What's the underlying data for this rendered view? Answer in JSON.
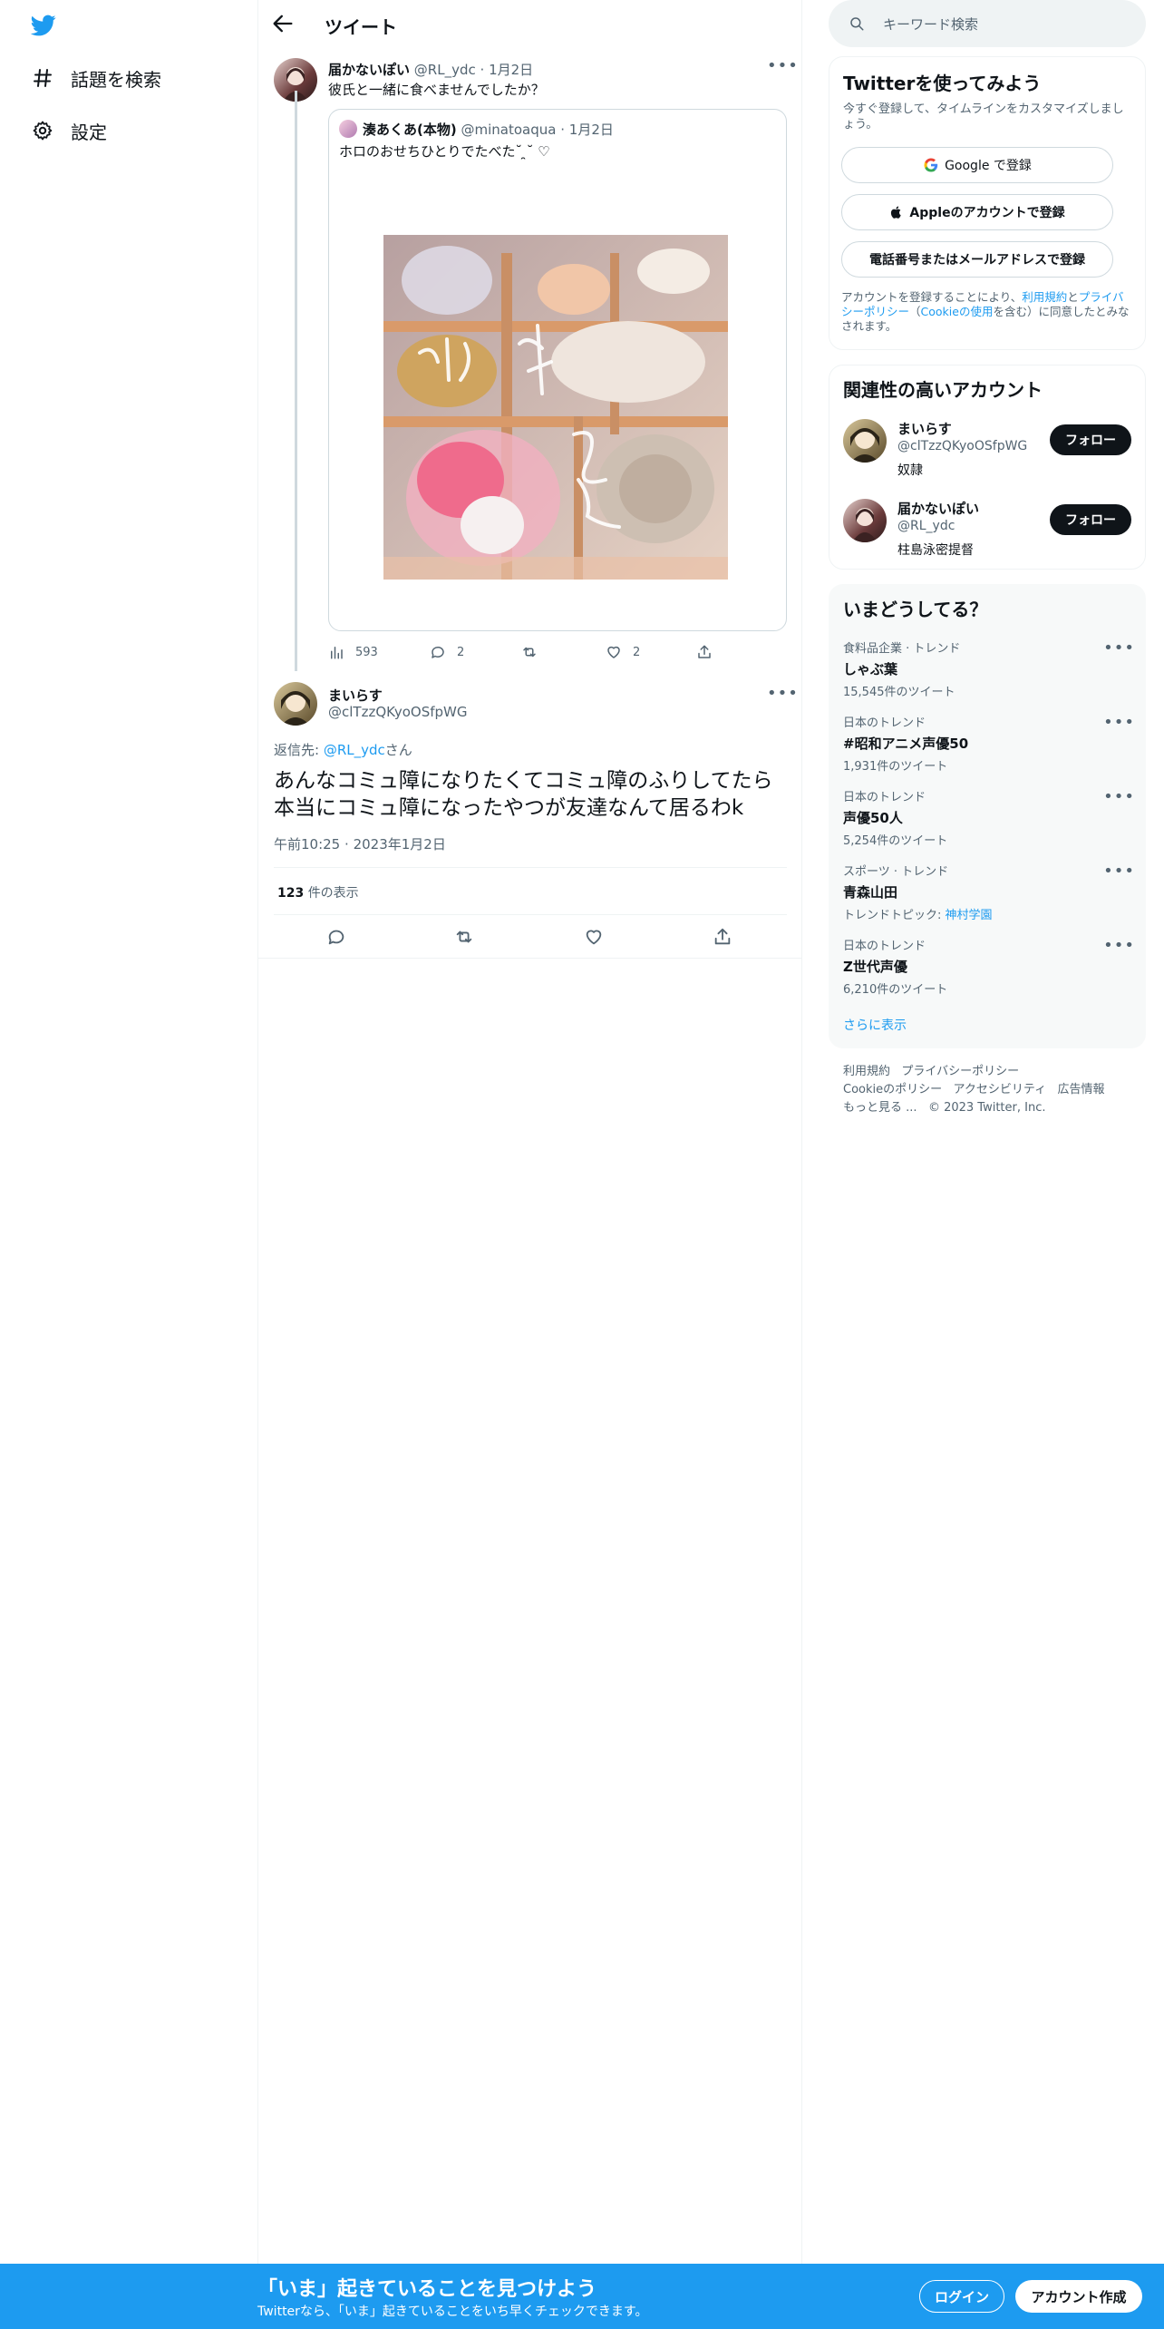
{
  "nav": {
    "explore_label": "話題を検索",
    "settings_label": "設定"
  },
  "header": {
    "title": "ツイート"
  },
  "parent_tweet": {
    "display_name": "届かないぽい",
    "handle": "@RL_ydc",
    "date": "1月2日",
    "text": "彼氏と一緒に食べませんでしたか？",
    "stats": {
      "views": "593",
      "replies": "2",
      "likes": "2"
    }
  },
  "quoted_tweet": {
    "display_name": "湊あくあ(本物)",
    "handle": "@minatoaqua",
    "date": "1月2日",
    "text": "ホロのおせちひとりでたべた˘ ̯˘ ♡",
    "image_overlay_text": "おせち"
  },
  "main_tweet": {
    "display_name": "まいらす",
    "handle": "@clTzzQKyoOSfpWG",
    "reply_prefix": "返信先: ",
    "reply_to": "@RL_ydc",
    "reply_suffix": "さん",
    "text": "あんなコミュ障になりたくてコミュ障のふりしてたら本当にコミュ障になったやつが友達なんて居るわk",
    "time": "午前10:25",
    "date": "2023年1月2日",
    "views_count": "123",
    "views_label": "件の表示"
  },
  "sidebar": {
    "search_placeholder": "キーワード検索",
    "signup": {
      "title": "Twitterを使ってみよう",
      "subtitle": "今すぐ登録して、タイムラインをカスタマイズしましょう。",
      "google_label": "Google で登録",
      "apple_label": "Appleのアカウントで登録",
      "email_label": "電話番号またはメールアドレスで登録",
      "terms_prefix": "アカウントを登録することにより、",
      "terms_link": "利用規約",
      "terms_and": "と",
      "privacy_link": "プライバシーポリシー",
      "cookie_open": "（",
      "cookie_link": "Cookieの使用",
      "terms_suffix": "を含む）に同意したとみなされます。"
    },
    "related": {
      "title": "関連性の高いアカウント",
      "follow_label": "フォロー",
      "accounts": [
        {
          "name": "まいらす",
          "handle": "@clTzzQKyoOSfpWG",
          "bio": "奴隷"
        },
        {
          "name": "届かないぽい",
          "handle": "@RL_ydc",
          "bio": "柱島泳密提督"
        }
      ]
    },
    "trends": {
      "title": "いまどうしてる？",
      "items": [
        {
          "context": "食料品企業 · トレンド",
          "name": "しゃぶ葉",
          "meta": "15,545件のツイート",
          "topic_link": ""
        },
        {
          "context": "日本のトレンド",
          "name": "#昭和アニメ声優50",
          "meta": "1,931件のツイート",
          "topic_link": ""
        },
        {
          "context": "日本のトレンド",
          "name": "声優50人",
          "meta": "5,254件のツイート",
          "topic_link": ""
        },
        {
          "context": "スポーツ · トレンド",
          "name": "青森山田",
          "meta": "トレンドトピック: ",
          "topic_link": "神村学園"
        },
        {
          "context": "日本のトレンド",
          "name": "Z世代声優",
          "meta": "6,210件のツイート",
          "topic_link": ""
        }
      ],
      "show_more": "さらに表示"
    },
    "footer": {
      "terms": "利用規約",
      "privacy": "プライバシーポリシー",
      "cookie": "Cookieのポリシー",
      "accessibility": "アクセシビリティ",
      "ads": "広告情報",
      "more": "もっと見る ...",
      "copyright": "© 2023 Twitter, Inc."
    }
  },
  "banner": {
    "title": "「いま」起きていることを見つけよう",
    "subtitle": "Twitterなら、「いま」起きていることをいち早くチェックできます。",
    "login_label": "ログイン",
    "signup_label": "アカウント作成"
  },
  "colors": {
    "accent": "#1d9bf0",
    "text": "#0f1419",
    "muted": "#536471",
    "border": "#cfd9de"
  }
}
